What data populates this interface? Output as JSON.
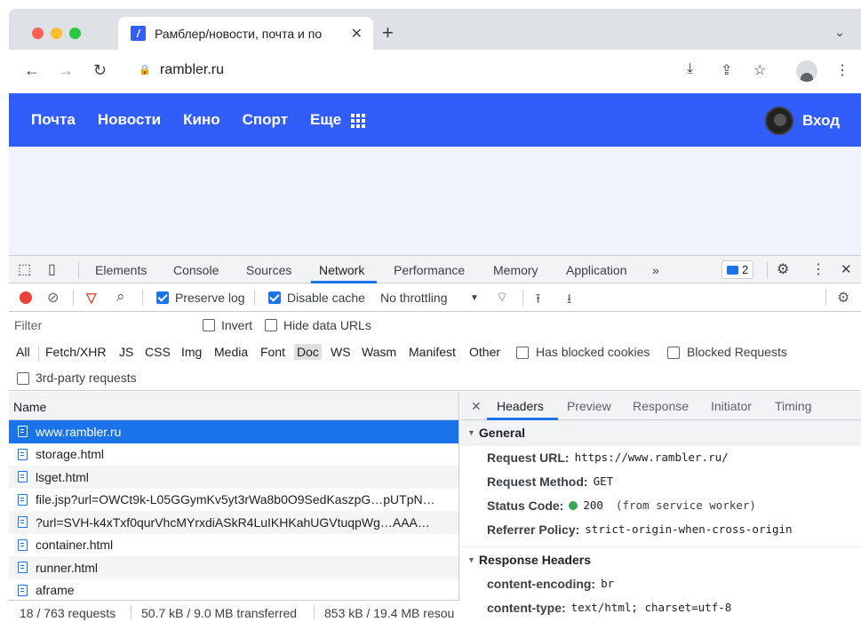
{
  "browser": {
    "tab": {
      "favicon": "/",
      "title": "Рамблер/новости, почта и по",
      "close": "✕"
    },
    "new_tab": "+",
    "tabs_dropdown": "⌄",
    "nav": {
      "back": "←",
      "forward": "→",
      "reload": "↻"
    },
    "lock_icon": "🔒",
    "url": "rambler.ru",
    "toolbar_icons": {
      "install": "⤓",
      "share": "⇪",
      "bookmark": "☆",
      "menu": "⋮"
    }
  },
  "site": {
    "nav": [
      "Почта",
      "Новости",
      "Кино",
      "Спорт",
      "Еще"
    ],
    "login": "Вход",
    "brand_color": "#315efb"
  },
  "devtools": {
    "tabs": [
      "Elements",
      "Console",
      "Sources",
      "Network",
      "Performance",
      "Memory",
      "Application"
    ],
    "active_tab": "Network",
    "more_tabs": "»",
    "issues_count": "2",
    "icons": {
      "inspect": "⬚",
      "device": "▯",
      "settings": "⚙",
      "kebab": "⋮",
      "close": "✕"
    },
    "toolbar": {
      "clear_icon": "⊘",
      "filter_icon": "▽",
      "search_icon": "⌕",
      "preserve_log": "Preserve log",
      "disable_cache": "Disable cache",
      "throttling": "No throttling",
      "throttle_arrow": "▼",
      "conditions_icon": "⌔",
      "import_icon": "⭱",
      "export_icon": "⭳",
      "settings_icon": "⚙"
    },
    "filter": {
      "placeholder": "Filter",
      "invert": "Invert",
      "hide_data_urls": "Hide data URLs"
    },
    "types": [
      "All",
      "Fetch/XHR",
      "JS",
      "CSS",
      "Img",
      "Media",
      "Font",
      "Doc",
      "WS",
      "Wasm",
      "Manifest",
      "Other"
    ],
    "selected_type": "Doc",
    "has_blocked_cookies": "Has blocked cookies",
    "blocked_requests": "Blocked Requests",
    "third_party": "3rd-party requests",
    "list": {
      "header": "Name",
      "rows": [
        "www.rambler.ru",
        "storage.html",
        "lsget.html",
        "file.jsp?url=OWCt9k-L05GGymKv5yt3rWa8b0O9SedKaszpG…pUTpN…",
        "?url=SVH-k4xTxf0qurVhcMYrxdiASkR4LuIKHKahUGVtuqpWg…AAA…",
        "container.html",
        "runner.html",
        "aframe"
      ],
      "selected_index": 0
    },
    "status": {
      "requests": "18 / 763 requests",
      "transferred": "50.7 kB / 9.0 MB transferred",
      "resources": "853 kB / 19.4 MB resou"
    },
    "detail": {
      "close": "✕",
      "tabs": [
        "Headers",
        "Preview",
        "Response",
        "Initiator",
        "Timing"
      ],
      "active_tab": "Headers",
      "general": {
        "title": "General",
        "request_url_label": "Request URL:",
        "request_url": "https://www.rambler.ru/",
        "request_method_label": "Request Method:",
        "request_method": "GET",
        "status_code_label": "Status Code:",
        "status_code": "200",
        "status_note": "(from service worker)",
        "referrer_policy_label": "Referrer Policy:",
        "referrer_policy": "strict-origin-when-cross-origin"
      },
      "response_headers": {
        "title": "Response Headers",
        "content_encoding_label": "content-encoding:",
        "content_encoding": "br",
        "content_type_label": "content-type:",
        "content_type": "text/html; charset=utf-8"
      }
    }
  }
}
